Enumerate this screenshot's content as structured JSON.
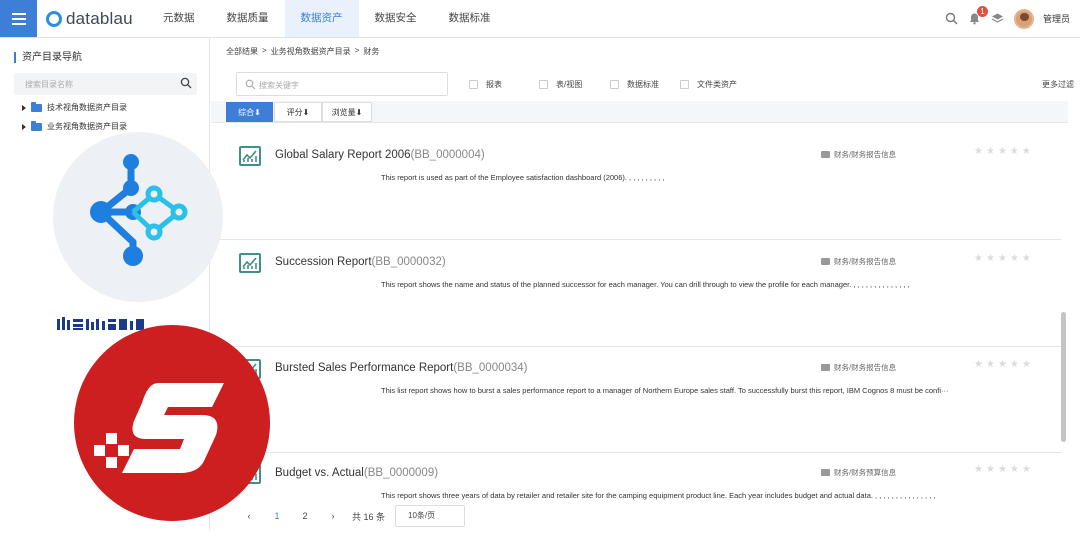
{
  "header": {
    "logo_text": "datablau",
    "nav": [
      {
        "label": "元数据",
        "active": false
      },
      {
        "label": "数据质量",
        "active": false
      },
      {
        "label": "数据资产",
        "active": true
      },
      {
        "label": "数据安全",
        "active": false
      },
      {
        "label": "数据标准",
        "active": false
      }
    ],
    "notification_count": "1",
    "user_name": "管理员",
    "accent_color": "#3d7fd6"
  },
  "sidebar": {
    "title": "资产目录导航",
    "search_placeholder": "搜索目录名称",
    "tree": [
      {
        "label": "技术视角数据资产目录"
      },
      {
        "label": "业务视角数据资产目录"
      }
    ]
  },
  "breadcrumb": [
    "全部结果",
    ">",
    "业务视角数据资产目录",
    ">",
    "财务"
  ],
  "filters": {
    "search_placeholder": "搜索关键字",
    "options": [
      "报表",
      "表/视图",
      "数据标准",
      "文件类资产"
    ],
    "more": "更多过滤"
  },
  "sort": [
    "综合⬇",
    "评分⬇",
    "浏览量⬇"
  ],
  "results": [
    {
      "name": "Global Salary Report 2006",
      "code": "(BB_0000004)",
      "description": "This report is used as part of the Employee satisfaction dashboard (2006). , , , , , , , , ,",
      "path": "财务/财务报告信息",
      "rating": 0
    },
    {
      "name": "Succession Report",
      "code": "(BB_0000032)",
      "description": "This report shows the name and status of the planned successor for each manager. You can drill through to view the profile for each manager. , , , , , , , , , , , , , ,",
      "path": "财务/财务报告信息",
      "rating": 0
    },
    {
      "name": "Bursted Sales Performance Report",
      "code": "(BB_0000034)",
      "description": "This list report shows how to burst a sales performance report to a manager of Northern Europe sales staff. To successfully burst this report, IBM Cognos 8 must be confi···",
      "path": "财务/财务报告信息",
      "rating": 0
    },
    {
      "name": "Budget vs. Actual",
      "code": "(BB_0000009)",
      "description": "This report shows three years of data by retailer and retailer site for the camping equipment product line. Each year includes budget and actual data. , , , , , , , , , , , , , , ,",
      "path": "财务/财务预算信息",
      "rating": 0
    }
  ],
  "pagination": {
    "prev": "‹",
    "pages": [
      "1",
      "2"
    ],
    "current": "1",
    "next": "›",
    "total": "共 16 条",
    "page_size": "10条/页"
  }
}
